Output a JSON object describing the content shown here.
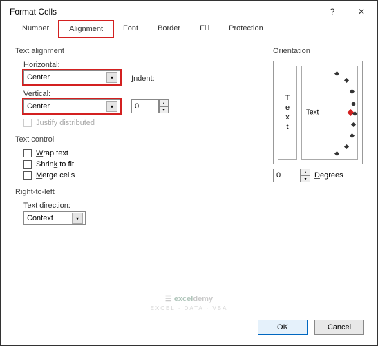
{
  "title": "Format Cells",
  "tabs": [
    "Number",
    "Alignment",
    "Font",
    "Border",
    "Fill",
    "Protection"
  ],
  "activeTab": 1,
  "alignment": {
    "sectionLabel": "Text alignment",
    "horizontalLabel": "Horizontal:",
    "horizontalValue": "Center",
    "verticalLabel": "Vertical:",
    "verticalValue": "Center",
    "indentLabel": "Indent:",
    "indentValue": "0",
    "justifyLabel": "Justify distributed"
  },
  "textControl": {
    "sectionLabel": "Text control",
    "wrap": "Wrap text",
    "shrink": "Shrink to fit",
    "merge": "Merge cells"
  },
  "rtl": {
    "sectionLabel": "Right-to-left",
    "directionLabel": "Text direction:",
    "directionValue": "Context"
  },
  "orientation": {
    "label": "Orientation",
    "verticalText": "Text",
    "dialLabel": "Text",
    "degreesLabel": "Degrees",
    "degreesValue": "0"
  },
  "buttons": {
    "ok": "OK",
    "cancel": "Cancel"
  },
  "watermark": {
    "brand1": "excel",
    "brand2": "demy",
    "sub": "EXCEL · DATA · VBA"
  }
}
